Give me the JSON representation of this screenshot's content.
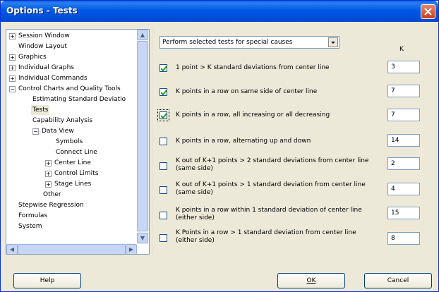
{
  "window": {
    "title": "Options - Tests"
  },
  "tree": {
    "items": [
      {
        "label": "Session Window",
        "expander": "+"
      },
      {
        "label": "Window Layout"
      },
      {
        "label": "Graphics",
        "expander": "+"
      },
      {
        "label": "Individual Graphs",
        "expander": "+"
      },
      {
        "label": "Individual Commands",
        "expander": "+"
      },
      {
        "label": "Control Charts and Quality Tools",
        "expander": "−"
      },
      {
        "label": "Estimating Standard Deviatio"
      },
      {
        "label": "Tests",
        "selected": true
      },
      {
        "label": "Capability Analysis"
      },
      {
        "label": "Data View",
        "expander": "−"
      },
      {
        "label": "Symbols"
      },
      {
        "label": "Connect Line"
      },
      {
        "label": "Center Line",
        "expander": "+"
      },
      {
        "label": "Control Limits",
        "expander": "+"
      },
      {
        "label": "Stage Lines",
        "expander": "+"
      },
      {
        "label": "Other"
      },
      {
        "label": "Stepwise Regression"
      },
      {
        "label": "Formulas"
      },
      {
        "label": "System"
      }
    ]
  },
  "test_mode": {
    "selected": "Perform selected tests for special causes"
  },
  "k_header": "K",
  "tests": [
    {
      "label_1": "1 point > K standard deviations from center line",
      "label_2": "",
      "checked": true,
      "k": "3"
    },
    {
      "label_1": "K points in a row on same side of center line",
      "label_2": "",
      "checked": true,
      "k": "7"
    },
    {
      "label_1": "K points in a row, all increasing or all decreasing",
      "label_2": "",
      "checked": true,
      "k": "7"
    },
    {
      "label_1": "K points in a row, alternating up and down",
      "label_2": "",
      "checked": false,
      "k": "14"
    },
    {
      "label_1": "K out of K+1 points > 2 standard deviations from center line",
      "label_2": "(same side)",
      "checked": false,
      "k": "2"
    },
    {
      "label_1": "K out of K+1 points > 1 standard deviation from center line",
      "label_2": "(same side)",
      "checked": false,
      "k": "4"
    },
    {
      "label_1": "K points in a row within 1 standard deviation of center line",
      "label_2": "(either side)",
      "checked": false,
      "k": "15"
    },
    {
      "label_1": "K Points in a row > 1 standard deviation from center line",
      "label_2": "(either side)",
      "checked": false,
      "k": "8"
    }
  ],
  "buttons": {
    "help": "Help",
    "ok": "OK",
    "cancel": "Cancel"
  }
}
